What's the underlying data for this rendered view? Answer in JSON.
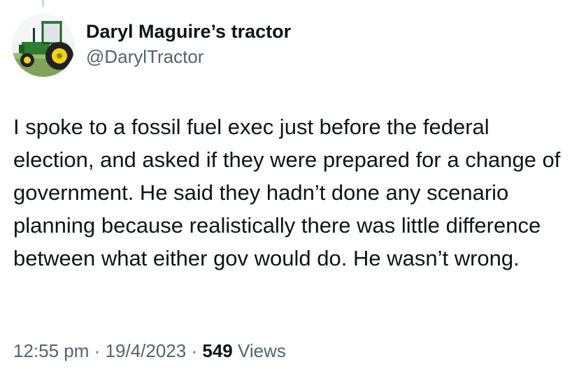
{
  "author": {
    "display_name": "Daryl Maguire’s tractor",
    "handle": "@DarylTractor",
    "avatar_icon": "tractor-avatar-icon"
  },
  "tweet": {
    "text": "I spoke to a fossil fuel exec just before the federal election, and asked if they were prepared for a change of government. He said they hadn’t done any scenario planning because realistically there was little difference between what either gov would do. He wasn’t wrong."
  },
  "meta": {
    "time": "12:55 pm",
    "separator": "·",
    "date": "19/4/2023",
    "views_count": "549",
    "views_label": "Views"
  },
  "colors": {
    "text_primary": "#0f1419",
    "text_secondary": "#536471",
    "tractor_green": "#2e7d32",
    "tractor_yellow": "#f2d21b"
  }
}
